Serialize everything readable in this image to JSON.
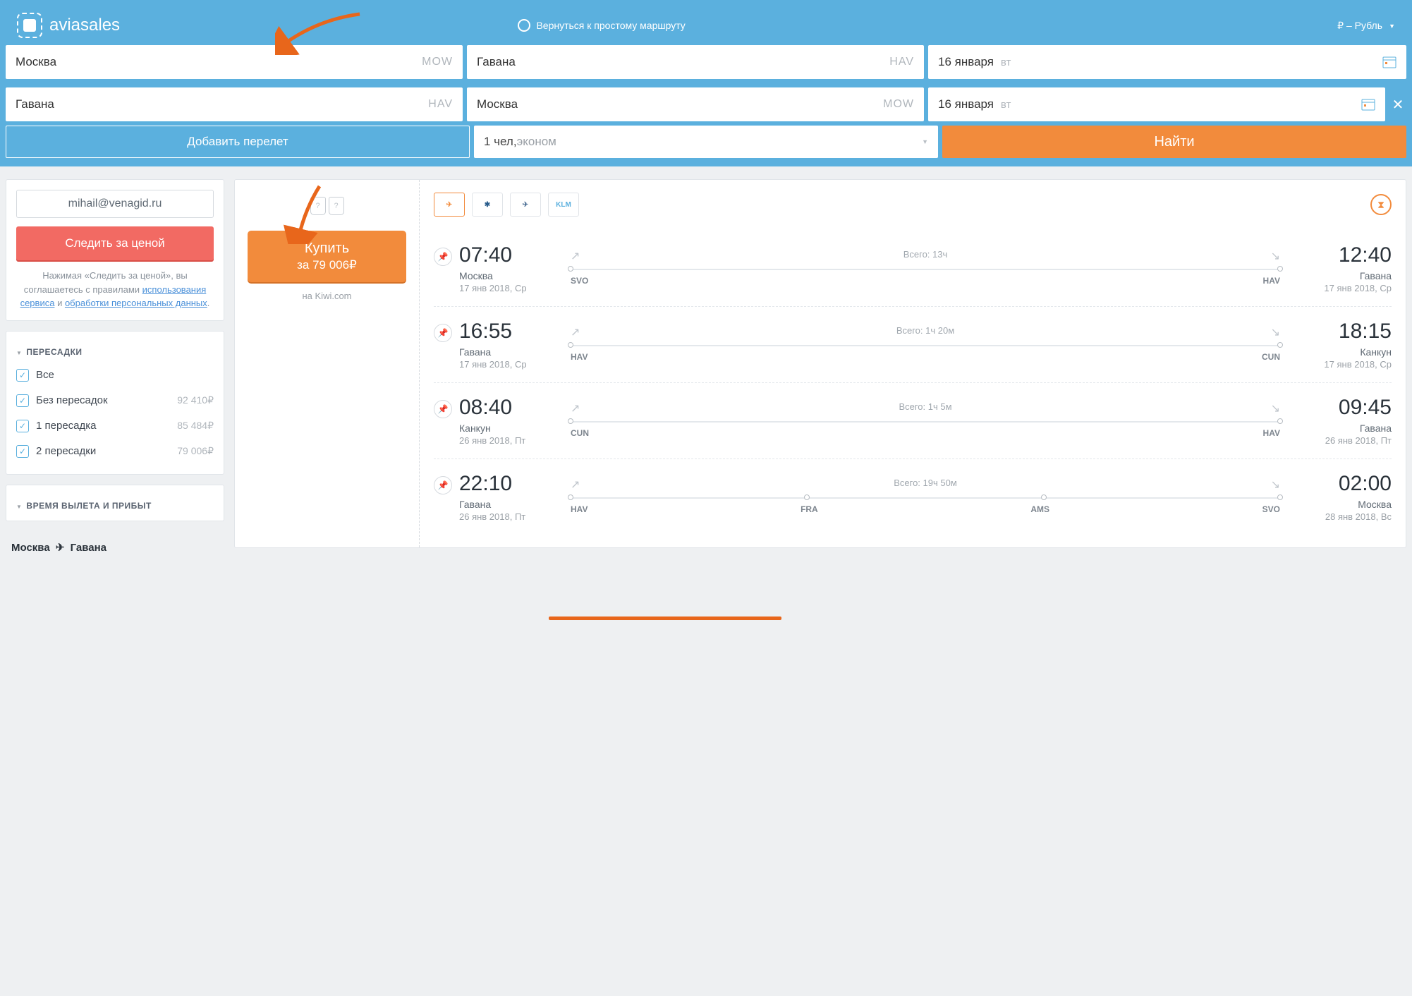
{
  "header": {
    "brand": "aviasales",
    "simple_route": "Вернуться к простому маршруту",
    "currency": "₽ – Рубль"
  },
  "search": {
    "rows": [
      {
        "from": "Москва",
        "from_code": "MOW",
        "to": "Гавана",
        "to_code": "HAV",
        "date": "16 января",
        "weekday": "вт"
      },
      {
        "from": "Гавана",
        "from_code": "HAV",
        "to": "Москва",
        "to_code": "MOW",
        "date": "16 января",
        "weekday": "вт"
      }
    ],
    "add_flight": "Добавить перелет",
    "passengers_num": "1 чел, ",
    "passengers_class": "эконом",
    "search_btn": "Найти"
  },
  "watch": {
    "email": "mihail@venagid.ru",
    "btn": "Следить за ценой",
    "legal_pre": "Нажимая «Следить за ценой», вы соглашаетесь с правилами ",
    "tos": "использования сервиса",
    "and": " и ",
    "privacy": "обработки персональных данных",
    "dot": "."
  },
  "filters": {
    "transfers_title": "ПЕРЕСАДКИ",
    "transfers": [
      {
        "label": "Все",
        "price": ""
      },
      {
        "label": "Без пересадок",
        "price": "92 410₽"
      },
      {
        "label": "1 пересадка",
        "price": "85 484₽"
      },
      {
        "label": "2 пересадки",
        "price": "79 006₽"
      }
    ],
    "time_title": "ВРЕМЯ ВЫЛЕТА И ПРИБЫТ"
  },
  "route": {
    "from": "Москва",
    "to": "Гавана"
  },
  "ticket": {
    "buy_label": "Купить",
    "buy_price": "за 79 006₽",
    "seller": "на Kiwi.com",
    "carriers": [
      "Condor",
      "Interjet",
      "Aeroflot",
      "KLM"
    ],
    "segments": [
      {
        "dep_time": "07:40",
        "dep_city": "Москва",
        "dep_date": "17 янв 2018, Ср",
        "arr_time": "12:40",
        "arr_city": "Гавана",
        "arr_date": "17 янв 2018, Ср",
        "duration": "Всего: 13ч",
        "stops": [
          "SVO",
          "HAV"
        ]
      },
      {
        "dep_time": "16:55",
        "dep_city": "Гавана",
        "dep_date": "17 янв 2018, Ср",
        "arr_time": "18:15",
        "arr_city": "Канкун",
        "arr_date": "17 янв 2018, Ср",
        "duration": "Всего: 1ч 20м",
        "stops": [
          "HAV",
          "CUN"
        ]
      },
      {
        "dep_time": "08:40",
        "dep_city": "Канкун",
        "dep_date": "26 янв 2018, Пт",
        "arr_time": "09:45",
        "arr_city": "Гавана",
        "arr_date": "26 янв 2018, Пт",
        "duration": "Всего: 1ч 5м",
        "stops": [
          "CUN",
          "HAV"
        ]
      },
      {
        "dep_time": "22:10",
        "dep_city": "Гавана",
        "dep_date": "26 янв 2018, Пт",
        "arr_time": "02:00",
        "arr_city": "Москва",
        "arr_date": "28 янв 2018, Вс",
        "duration": "Всего: 19ч 50м",
        "stops": [
          "HAV",
          "FRA",
          "AMS",
          "SVO"
        ]
      }
    ]
  }
}
